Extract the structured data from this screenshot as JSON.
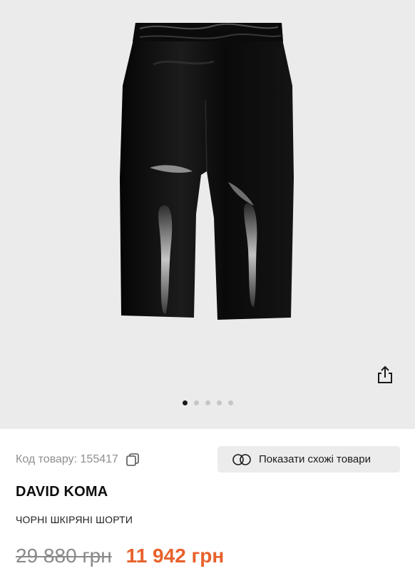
{
  "product": {
    "brand": "DAVID KOMA",
    "name": "ЧОРНІ ШКІРЯНІ ШОРТИ",
    "sku_text": "Код товару: 155417",
    "old_price": "29 880 грн",
    "new_price": "11 942 грн",
    "image_description_icon": "shorts-photo"
  },
  "gallery": {
    "total_images": 5,
    "active_index": 0
  },
  "actions": {
    "similar_label": "Показати схожі товари",
    "share_icon": "share-icon",
    "copy_icon": "copy-icon"
  },
  "colors": {
    "gallery_bg": "#ebebeb",
    "price_accent": "#e8612c",
    "old_price": "#8a8a8a"
  }
}
